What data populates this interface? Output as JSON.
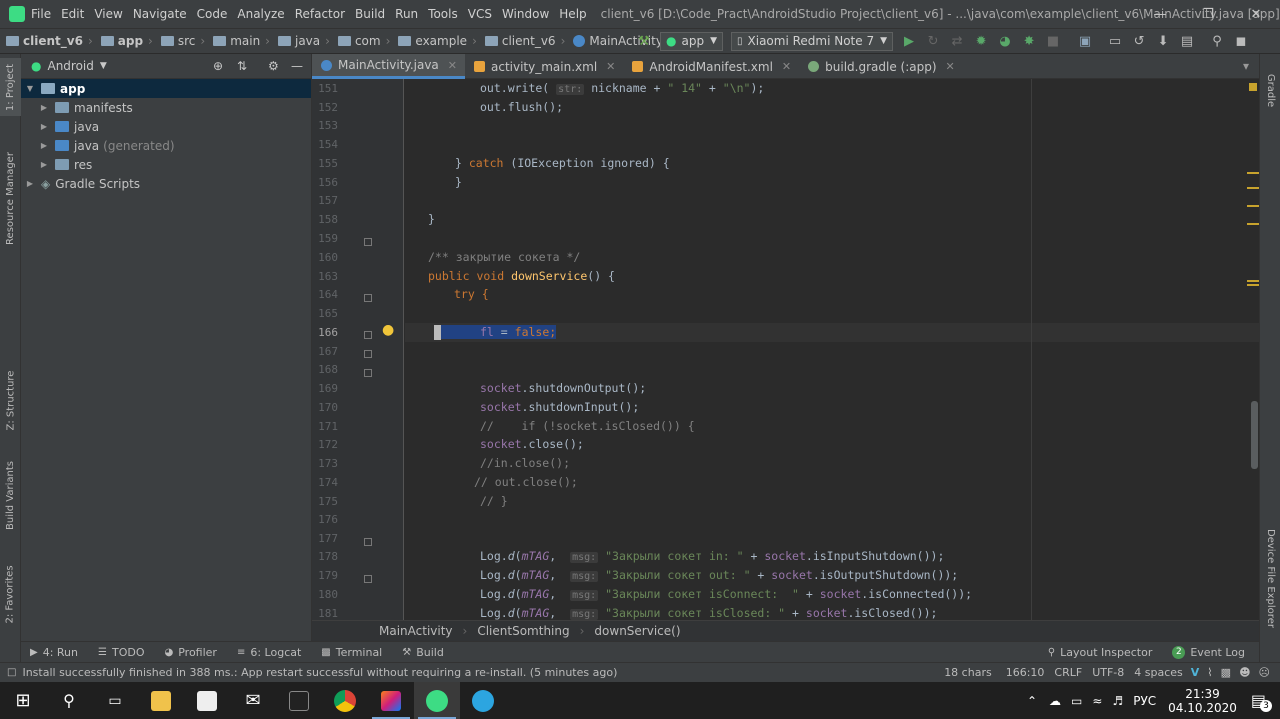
{
  "menubar": {
    "items": [
      "File",
      "Edit",
      "View",
      "Navigate",
      "Code",
      "Analyze",
      "Refactor",
      "Build",
      "Run",
      "Tools",
      "VCS",
      "Window",
      "Help"
    ],
    "window_title": "client_v6 [D:\\Code_Pract\\AndroidStudio Project\\client_v6] - ...\\java\\com\\example\\client_v6\\MainActivity.java [app]"
  },
  "navbar": {
    "crumbs": [
      "client_v6",
      "app",
      "src",
      "main",
      "java",
      "com",
      "example",
      "client_v6",
      "MainActivity"
    ],
    "run_config": "app",
    "device": "Xiaomi Redmi Note 7"
  },
  "project": {
    "view_label": "Android",
    "tree": [
      {
        "label": "app",
        "level": 0
      },
      {
        "label": "manifests",
        "level": 1
      },
      {
        "label": "java",
        "level": 1
      },
      {
        "label": "java",
        "suffix": "(generated)",
        "level": 1
      },
      {
        "label": "res",
        "level": 1
      },
      {
        "label": "Gradle Scripts",
        "level": 0
      }
    ]
  },
  "side_tabs": {
    "left": [
      "1: Project",
      "Resource Manager",
      "Z: Structure",
      "Build Variants",
      "2: Favorites"
    ],
    "right": [
      "Gradle",
      "Device File Explorer"
    ]
  },
  "tabs": [
    {
      "label": "MainActivity.java",
      "color": "#4a88c7"
    },
    {
      "label": "activity_main.xml",
      "color": "#e8a33d"
    },
    {
      "label": "AndroidManifest.xml",
      "color": "#e8a33d"
    },
    {
      "label": "build.gradle (:app)",
      "color": "#7aa87a"
    }
  ],
  "code": {
    "line_numbers": [
      "151",
      "152",
      "153",
      "154",
      "155",
      "156",
      "157",
      "158",
      "159",
      "160",
      "163",
      "164",
      "165",
      "166",
      "167",
      "168",
      "169",
      "170",
      "171",
      "172",
      "173",
      "174",
      "175",
      "176",
      "177",
      "178",
      "179",
      "180",
      "181"
    ],
    "lines": {
      "l151_a": "out.write( ",
      "l151_hint": "str:",
      "l151_b": " nickname + ",
      "l151_s1": "\" 14\"",
      "l151_c": " + ",
      "l151_s2": "\"\\n\"",
      "l151_d": ");",
      "l152": "out.flush();",
      "l155_a": "} ",
      "l155_kw": "catch",
      "l155_b": " (IOException ignored) {",
      "l156": "}",
      "l158": "}",
      "l160": "/** закрытие сокета */",
      "l163_kw": "public void ",
      "l163_m": "downService",
      "l163_b": "() {",
      "l164": "try {",
      "l166_f": "fl",
      "l166_a": " = ",
      "l166_kw": "false",
      "l166_b": ";",
      "l169_f": "socket",
      "l169_b": ".shutdownOutput();",
      "l170_f": "socket",
      "l170_b": ".shutdownInput();",
      "l171": "//    if (!socket.isClosed()) {",
      "l172_f": "socket",
      "l172_b": ".close();",
      "l173": "//in.close();",
      "l174": "// out.close();",
      "l175": "// }",
      "l178_a": "Log.",
      "l178_d": "d",
      "l178_t": "mTAG",
      "l178_hint": "msg:",
      "l178_s": "\"Закрыли сокет in: \"",
      "l178_b": " + ",
      "l178_f": "socket",
      "l178_c": ".isInputShutdown());",
      "l179_a": "Log.",
      "l179_d": "d",
      "l179_t": "mTAG",
      "l179_hint": "msg:",
      "l179_s": "\"Закрыли сокет out: \"",
      "l179_b": " + ",
      "l179_f": "socket",
      "l179_c": ".isOutputShutdown());",
      "l180_a": "Log.",
      "l180_d": "d",
      "l180_t": "mTAG",
      "l180_hint": "msg:",
      "l180_s": "\"Закрыли сокет isConnect:  \"",
      "l180_b": " + ",
      "l180_f": "socket",
      "l180_c": ".isConnected());",
      "l181_a": "Log.",
      "l181_d": "d",
      "l181_t": "mTAG",
      "l181_hint": "msg:",
      "l181_s": "\"Закрыли сокет isClosed: \"",
      "l181_b": " + ",
      "l181_f": "socket",
      "l181_c": ".isClosed());"
    }
  },
  "code_breadcrumb": [
    "MainActivity",
    "ClientSomthing",
    "downService()"
  ],
  "toolwindows": {
    "left": [
      {
        "icon": "run-icon",
        "label": "4: Run"
      },
      {
        "icon": "todo-icon",
        "label": "TODO"
      },
      {
        "icon": "profiler-icon",
        "label": "Profiler"
      },
      {
        "icon": "logcat-icon",
        "label": "6: Logcat"
      },
      {
        "icon": "terminal-icon",
        "label": "Terminal"
      },
      {
        "icon": "build-icon",
        "label": "Build"
      }
    ],
    "right": [
      {
        "icon": "layout-inspector-icon",
        "label": "Layout Inspector"
      },
      {
        "icon": "event-log-icon",
        "label": "Event Log",
        "badge": "2"
      }
    ]
  },
  "status": {
    "message": "Install successfully finished in 388 ms.: App restart successful without requiring a re-install. (5 minutes ago)",
    "chars": "18 chars",
    "position": "166:10",
    "line_sep": "CRLF",
    "encoding": "UTF-8",
    "indent": "4 spaces"
  },
  "taskbar": {
    "lang": "РУС",
    "time": "21:39",
    "date": "04.10.2020",
    "notif_count": "3"
  }
}
